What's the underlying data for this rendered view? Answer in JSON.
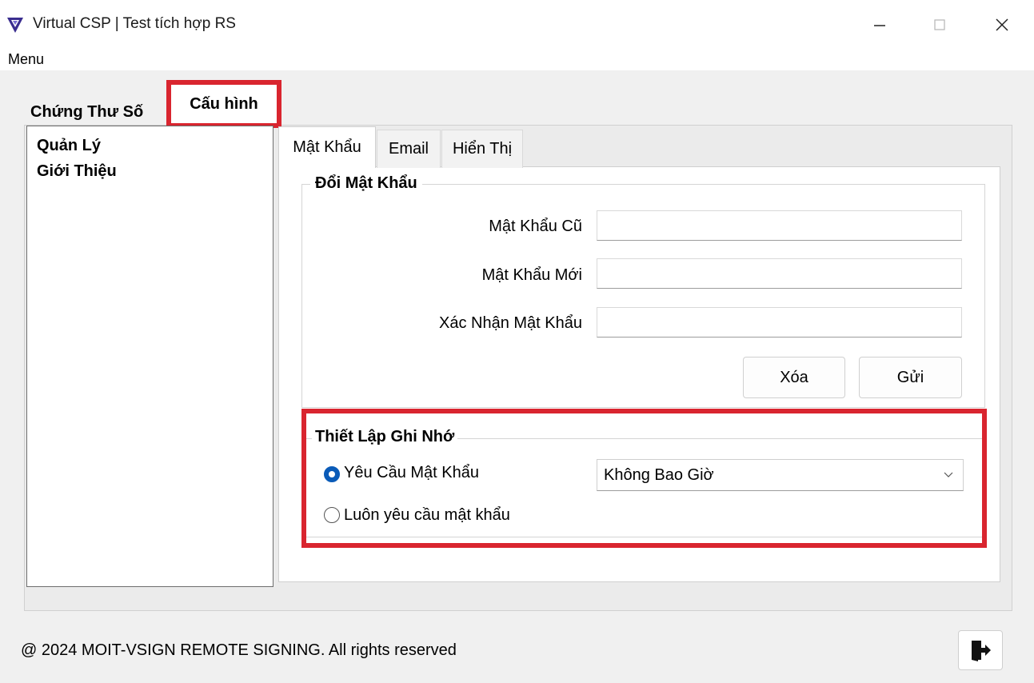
{
  "window": {
    "title": "Virtual CSP | Test tích hợp RS"
  },
  "menu": {
    "label": "Menu"
  },
  "outer_tabs": [
    {
      "label": "Chứng Thư Số"
    },
    {
      "label": "Cấu hình"
    }
  ],
  "left_list": [
    {
      "label": "Quản Lý"
    },
    {
      "label": "Giới Thiệu"
    }
  ],
  "inner_tabs": [
    {
      "label": "Mật Khẩu"
    },
    {
      "label": "Email"
    },
    {
      "label": "Hiển Thị"
    }
  ],
  "change_password": {
    "title": "Đổi Mật Khẩu",
    "old_label": "Mật Khẩu Cũ",
    "new_label": "Mật Khẩu Mới",
    "confirm_label": "Xác Nhận Mật Khẩu",
    "old_value": "",
    "new_value": "",
    "confirm_value": "",
    "clear_button": "Xóa",
    "send_button": "Gửi"
  },
  "remember": {
    "title": "Thiết Lập Ghi Nhớ",
    "option_require": "Yêu Cầu Mật Khẩu",
    "option_always": "Luôn yêu cầu mật khẩu",
    "selected_option": "option_require",
    "dropdown_value": "Không Bao Giờ"
  },
  "footer": {
    "copyright": "@ 2024 MOIT-VSIGN REMOTE SIGNING. All rights reserved"
  },
  "colors": {
    "highlight": "#d9252f",
    "radio_checked": "#0a5bb8",
    "app_icon": "#3a2d8f"
  },
  "icons": {
    "app": "vsign-logo-icon",
    "minimize": "minimize-icon",
    "maximize": "maximize-icon",
    "close": "close-icon",
    "chevron": "chevron-down-icon",
    "exit": "exit-icon"
  }
}
